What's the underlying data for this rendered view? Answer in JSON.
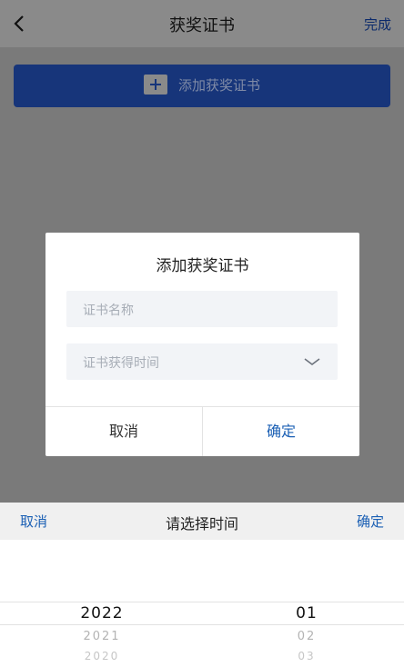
{
  "header": {
    "title": "获奖证书",
    "done_label": "完成"
  },
  "add_button": {
    "label": "添加获奖证书"
  },
  "dialog": {
    "title": "添加获奖证书",
    "name_placeholder": "证书名称",
    "date_placeholder": "证书获得时间",
    "cancel_label": "取消",
    "confirm_label": "确定"
  },
  "picker": {
    "cancel_label": "取消",
    "title": "请选择时间",
    "confirm_label": "确定",
    "years": [
      "2022",
      "2021",
      "2020"
    ],
    "months": [
      "01",
      "02",
      "03"
    ]
  }
}
